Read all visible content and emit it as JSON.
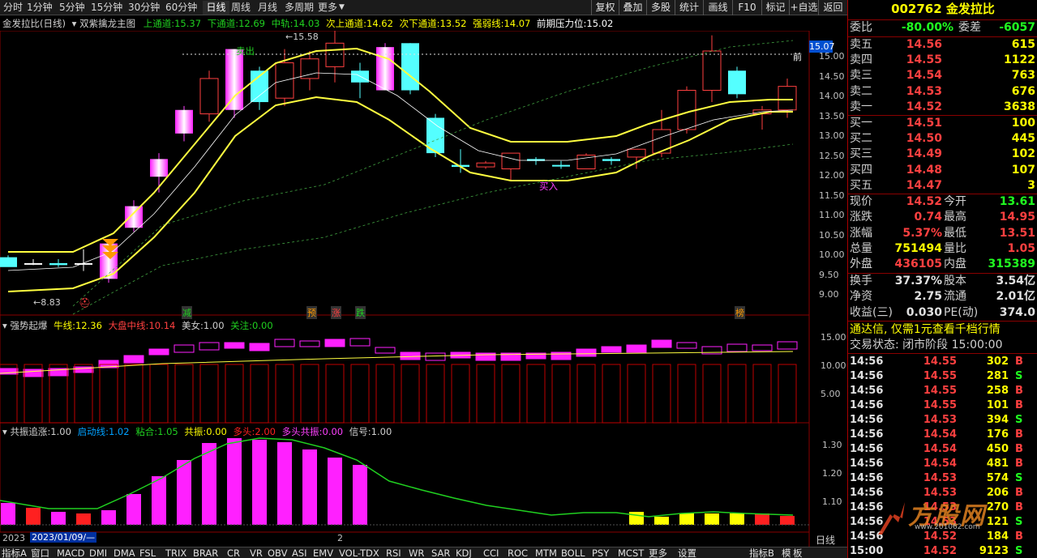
{
  "toolbar": {
    "periods": [
      "分时",
      "1分钟",
      "5分钟",
      "15分钟",
      "30分钟",
      "60分钟",
      "日线",
      "周线",
      "月线",
      "多周期",
      "更多"
    ],
    "active": "日线",
    "right": [
      "复权",
      "叠加",
      "多股",
      "统计",
      "画线",
      "F10",
      "标记",
      "+自选",
      "返回"
    ]
  },
  "info": {
    "name": "金发拉比(日线)",
    "indicator": "双紫擒龙主图",
    "up_label": "上通道:",
    "up_val": "15.37",
    "dn_label": "下通道:",
    "dn_val": "12.69",
    "mid_label": "中轨:",
    "mid_val": "14.03",
    "nup_label": "次上通道:",
    "nup_val": "14.62",
    "ndn_label": "次下通道:",
    "ndn_val": "13.52",
    "str_label": "强弱线:",
    "str_val": "14.07",
    "press_label": "前期压力位:",
    "press_val": "15.02"
  },
  "annotations": {
    "sell": "卖出",
    "buy": "买入",
    "high": "15.58",
    "low": "8.83",
    "front": "前",
    "price_tag": "15.07",
    "sig_jian": "减",
    "sig_yu": "预",
    "sig_zhang": "涨",
    "sig_die": "跌",
    "sig_bang": "榜"
  },
  "main_axis": [
    "15.00",
    "14.50",
    "14.00",
    "13.50",
    "13.00",
    "12.50",
    "12.00",
    "11.50",
    "11.00",
    "10.50",
    "10.00",
    "9.50",
    "9.00"
  ],
  "p2": {
    "title": "强势起爆",
    "niu_label": "牛线:",
    "niu_val": "12.36",
    "dapan_label": "大盘中线:",
    "dapan_val": "10.14",
    "meinv_label": "美女:",
    "meinv_val": "1.00",
    "guanzhu_label": "关注:",
    "guanzhu_val": "0.00",
    "axis": [
      "15.00",
      "10.00",
      "5.00"
    ]
  },
  "p3": {
    "title": "共振追涨",
    "title_val": ":1.00",
    "qd_label": "启动线:",
    "qd_val": "1.02",
    "nh_label": "粘合:",
    "nh_val": "1.05",
    "gz_label": "共振:",
    "gz_val": "0.00",
    "dt_label": "多头:",
    "dt_val": "2.00",
    "dtgz_label": "多头共振:",
    "dtgz_val": "0.00",
    "xh_label": "信号:",
    "xh_val": "1.00",
    "axis": [
      "1.30",
      "1.20",
      "1.10"
    ]
  },
  "dates": {
    "left": "2023",
    "date": "2023/01/09/—",
    "mid": "2",
    "period": "日线"
  },
  "bottom": [
    "指标A",
    "窗口",
    "MACD",
    "DMI",
    "DMA",
    "FSL",
    "TRIX",
    "BRAR",
    "CR",
    "VR",
    "OBV",
    "ASI",
    "EMV",
    "VOL-TDX",
    "RSI",
    "WR",
    "SAR",
    "KDJ",
    "CCI",
    "ROC",
    "MTM",
    "BOLL",
    "PSY",
    "MCST",
    "更多",
    "设置"
  ],
  "bottom_right": [
    "指标B",
    "模",
    "板"
  ],
  "quote": {
    "code": "002762",
    "name": "金发拉比",
    "wb_label": "委比",
    "wb_val": "-80.00%",
    "wc_label": "委差",
    "wc_val": "-6057",
    "asks": [
      {
        "l": "卖五",
        "p": "14.56",
        "v": "615"
      },
      {
        "l": "卖四",
        "p": "14.55",
        "v": "1122"
      },
      {
        "l": "卖三",
        "p": "14.54",
        "v": "763"
      },
      {
        "l": "卖二",
        "p": "14.53",
        "v": "676"
      },
      {
        "l": "卖一",
        "p": "14.52",
        "v": "3638"
      }
    ],
    "bids": [
      {
        "l": "买一",
        "p": "14.51",
        "v": "100"
      },
      {
        "l": "买二",
        "p": "14.50",
        "v": "445"
      },
      {
        "l": "买三",
        "p": "14.49",
        "v": "102"
      },
      {
        "l": "买四",
        "p": "14.48",
        "v": "107"
      },
      {
        "l": "买五",
        "p": "14.47",
        "v": "3"
      }
    ],
    "stats": [
      {
        "a": "现价",
        "av": "14.52",
        "b": "今开",
        "bv": "13.61"
      },
      {
        "a": "涨跌",
        "av": "0.74",
        "b": "最高",
        "bv": "14.95"
      },
      {
        "a": "涨幅",
        "av": "5.37%",
        "b": "最低",
        "bv": "13.51"
      },
      {
        "a": "总量",
        "av": "751494",
        "b": "量比",
        "bv": "1.05"
      },
      {
        "a": "外盘",
        "av": "436105",
        "b": "内盘",
        "bv": "315389"
      }
    ],
    "stats2": [
      {
        "a": "换手",
        "av": "37.37%",
        "b": "股本",
        "bv": "3.54亿"
      },
      {
        "a": "净资",
        "av": "2.75",
        "b": "流通",
        "bv": "2.01亿"
      },
      {
        "a": "收益(三)",
        "av": "0.030",
        "b": "PE(动)",
        "bv": "374.0"
      }
    ],
    "promo": "通达信, 仅需1元查看千档行情",
    "status": "交易状态: 闭市阶段 15:00:00",
    "ticks": [
      {
        "t": "14:56",
        "p": "14.55",
        "v": "302",
        "s": "B"
      },
      {
        "t": "14:56",
        "p": "14.55",
        "v": "281",
        "s": "S"
      },
      {
        "t": "14:56",
        "p": "14.55",
        "v": "258",
        "s": "B"
      },
      {
        "t": "14:56",
        "p": "14.55",
        "v": "101",
        "s": "B"
      },
      {
        "t": "14:56",
        "p": "14.53",
        "v": "394",
        "s": "S"
      },
      {
        "t": "14:56",
        "p": "14.54",
        "v": "176",
        "s": "B"
      },
      {
        "t": "14:56",
        "p": "14.54",
        "v": "450",
        "s": "B"
      },
      {
        "t": "14:56",
        "p": "14.54",
        "v": "481",
        "s": "B"
      },
      {
        "t": "14:56",
        "p": "14.53",
        "v": "574",
        "s": "S"
      },
      {
        "t": "14:56",
        "p": "14.53",
        "v": "206",
        "s": "B"
      },
      {
        "t": "14:56",
        "p": "14.53",
        "v": "270",
        "s": "B"
      },
      {
        "t": "14:56",
        "p": "14.53",
        "v": "121",
        "s": "S"
      },
      {
        "t": "14:56",
        "p": "14.52",
        "v": "184",
        "s": "B"
      },
      {
        "t": "15:00",
        "p": "14.52",
        "v": "9123",
        "s": "S"
      }
    ],
    "watermark": "方股网",
    "watermark_url": "www.201062.com"
  }
}
